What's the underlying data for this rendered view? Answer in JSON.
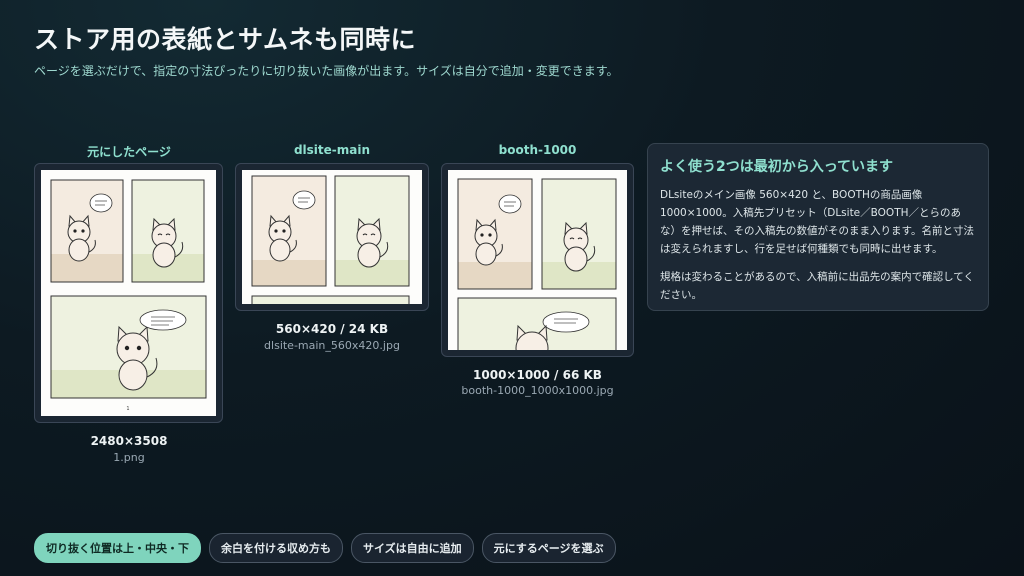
{
  "header": {
    "title": "ストア用の表紙とサムネも同時に",
    "subtitle": "ページを選ぶだけで、指定の寸法ぴったりに切り抜いた画像が出ます。サイズは自分で追加・変更できます。"
  },
  "previews": [
    {
      "label": "元にしたページ",
      "size": "2480×3508",
      "file": "1.png",
      "page_number": "1"
    },
    {
      "label": "dlsite-main",
      "size": "560×420 / 24 KB",
      "file": "dlsite-main_560x420.jpg"
    },
    {
      "label": "booth-1000",
      "size": "1000×1000 / 66 KB",
      "file": "booth-1000_1000x1000.jpg"
    }
  ],
  "info": {
    "heading": "よく使う2つは最初から入っています",
    "body1": "DLsiteのメイン画像 560×420 と、BOOTHの商品画像 1000×1000。入稿先プリセット（DLsite／BOOTH／とらのあな）を押せば、その入稿先の数値がそのまま入ります。名前と寸法は変えられますし、行を足せば何種類でも同時に出せます。",
    "body2": "規格は変わることがあるので、入稿前に出品先の案内で確認してください。"
  },
  "chips": [
    "切り抜く位置は上・中央・下",
    "余白を付ける収め方も",
    "サイズは自由に追加",
    "元にするページを選ぶ"
  ],
  "colors": {
    "accent": "#8fe0cf",
    "chip_active": "#7fd4bd",
    "panel": "#1c2834"
  }
}
